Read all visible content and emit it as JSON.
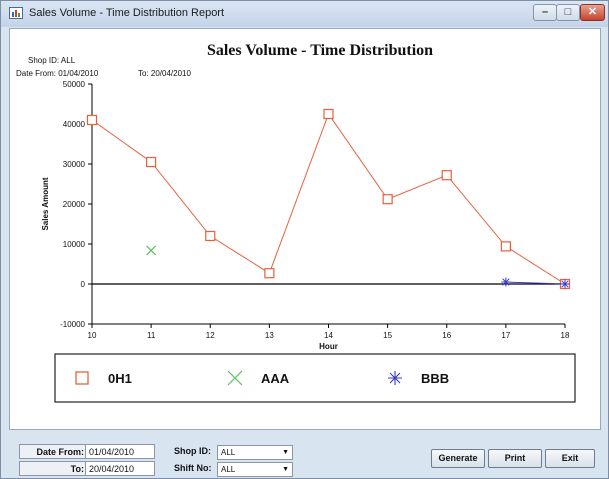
{
  "window": {
    "title": "Sales Volume - Time Distribution Report",
    "min_glyph": "–",
    "max_glyph": "□",
    "close_glyph": "✕"
  },
  "report": {
    "title": "Sales Volume - Time Distribution",
    "shop_id": "Shop ID: ALL",
    "date_from_label": "Date From: 01/04/2010",
    "date_to_label": "To: 20/04/2010"
  },
  "chart_data": {
    "type": "line",
    "title": "Sales Volume - Time Distribution",
    "xlabel": "Hour",
    "ylabel": "Sales Amount",
    "x": [
      10,
      11,
      12,
      13,
      14,
      15,
      16,
      17,
      18
    ],
    "xlim": [
      10,
      18
    ],
    "ylim": [
      -10000,
      50000
    ],
    "y_ticks": [
      -10000,
      0,
      10000,
      20000,
      30000,
      40000,
      50000
    ],
    "grid": false,
    "legend_position": "bottom",
    "series": [
      {
        "name": "0H1",
        "marker": "square",
        "color": "#e8603c",
        "points": [
          [
            10,
            41000
          ],
          [
            11,
            30500
          ],
          [
            12,
            12000
          ],
          [
            13,
            2700
          ],
          [
            14,
            42500
          ],
          [
            15,
            21200
          ],
          [
            16,
            27200
          ],
          [
            17,
            9400
          ],
          [
            18,
            0
          ]
        ]
      },
      {
        "name": "AAA",
        "marker": "x",
        "color": "#5cc05c",
        "points": [
          [
            11,
            8400
          ]
        ]
      },
      {
        "name": "BBB",
        "marker": "asterisk",
        "color": "#3a3ac8",
        "points": [
          [
            17,
            500
          ],
          [
            18,
            0
          ]
        ]
      }
    ]
  },
  "controls": {
    "date_from_label": "Date From:",
    "date_from_value": "01/04/2010",
    "to_label": "To:",
    "to_value": "20/04/2010",
    "shop_id_label": "Shop ID:",
    "shop_id_value": "ALL",
    "shift_no_label": "Shift No:",
    "shift_no_value": "ALL"
  },
  "buttons": {
    "generate": "Generate",
    "print": "Print",
    "exit": "Exit"
  }
}
